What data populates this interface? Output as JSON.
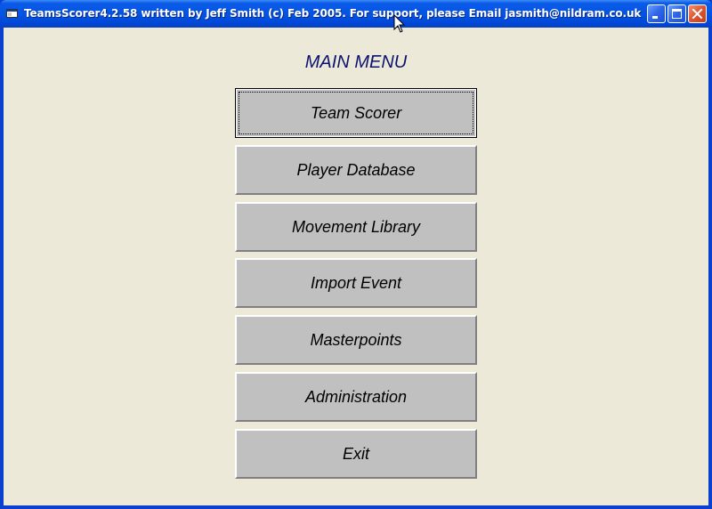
{
  "window": {
    "title": "TeamsScorer4.2.58 written by Jeff Smith (c) Feb 2005.  For support, please Email jasmith@nildram.co.uk",
    "icons": {
      "app": "app-window-icon",
      "minimize": "minimize-icon",
      "maximize": "maximize-icon",
      "close": "close-icon"
    }
  },
  "main": {
    "heading": "MAIN MENU",
    "buttons": [
      {
        "label": "Team Scorer",
        "focused": true
      },
      {
        "label": "Player Database"
      },
      {
        "label": "Movement Library"
      },
      {
        "label": "Import Event"
      },
      {
        "label": "Masterpoints"
      },
      {
        "label": "Administration"
      },
      {
        "label": "Exit"
      }
    ]
  },
  "colors": {
    "titlebar": "#0454E2",
    "background": "#ECE9D8",
    "button_face": "#C0C0C0",
    "heading_text": "#0C1270",
    "close_button": "#DD5530"
  }
}
